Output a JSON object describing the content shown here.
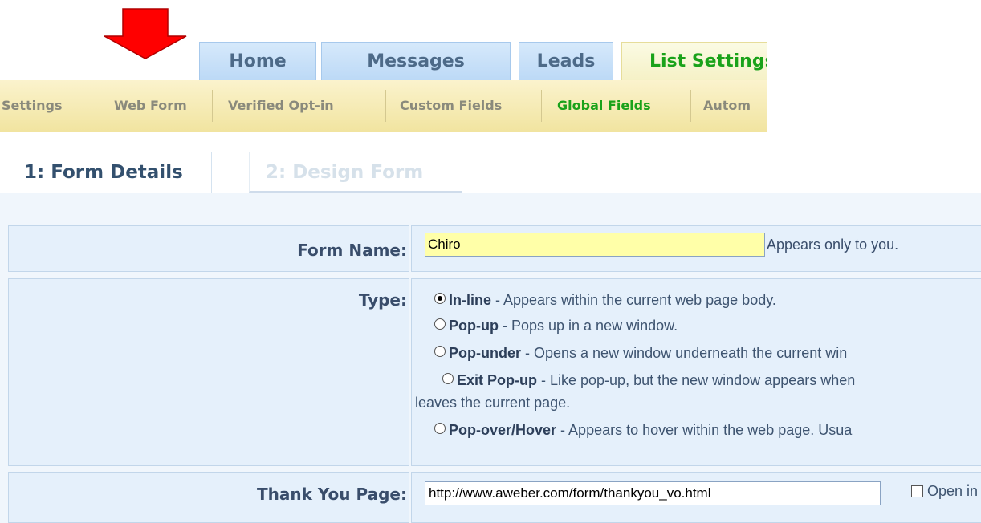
{
  "main_tabs": [
    {
      "label": "Home"
    },
    {
      "label": "Messages"
    },
    {
      "label": "Leads"
    },
    {
      "label": "List Settings"
    }
  ],
  "sub_tabs": [
    {
      "label": "Settings"
    },
    {
      "label": "Web Form"
    },
    {
      "label": "Verified Opt-in"
    },
    {
      "label": "Custom Fields"
    },
    {
      "label": "Global Fields"
    },
    {
      "label": "Autom"
    }
  ],
  "steps": [
    {
      "label": "1: Form Details"
    },
    {
      "label": "2: Design Form"
    }
  ],
  "form": {
    "name_label": "Form Name:",
    "name_value": "Chiro",
    "name_hint": "Appears only to you.",
    "type_label": "Type:",
    "type_options": [
      {
        "name": "In-line",
        "desc": " - Appears within the current web page body."
      },
      {
        "name": "Pop-up",
        "desc": " - Pops up in a new window."
      },
      {
        "name": "Pop-under",
        "desc": " - Opens a new window underneath the current win"
      },
      {
        "name": "Exit Pop-up",
        "desc": " - Like pop-up, but the new window appears when",
        "desc2": "leaves the current page."
      },
      {
        "name": "Pop-over/Hover",
        "desc": " - Appears to hover within the web page. Usua"
      }
    ],
    "selected_type": "In-line",
    "thankyou_label": "Thank You Page:",
    "thankyou_value": "http://www.aweber.com/form/thankyou_vo.html",
    "open_in_label": "Open in"
  },
  "colors": {
    "arrow": "#ff0000",
    "active_tab_text": "#1aa21a",
    "label_text": "#394d6b"
  }
}
